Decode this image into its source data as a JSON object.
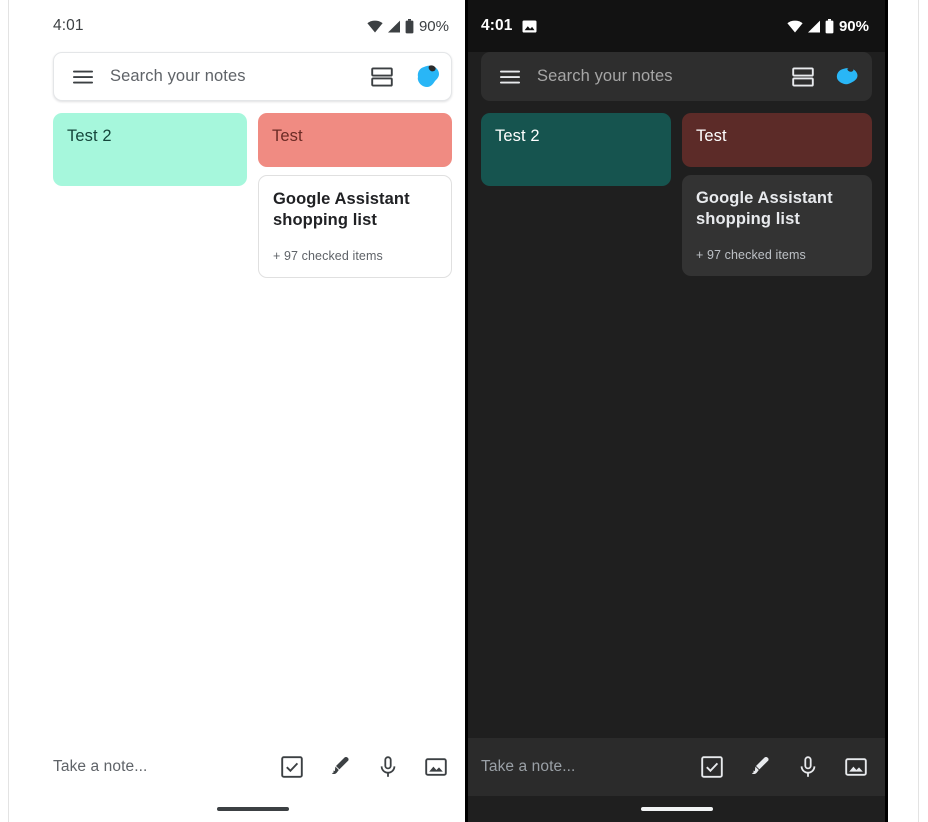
{
  "panels": [
    {
      "theme": "light",
      "statusbar": {
        "time": "4:01",
        "battery_percent": "90%",
        "icons": [
          "wifi-icon",
          "cellular-signal-icon",
          "battery-icon"
        ],
        "notification_icons": []
      },
      "search": {
        "placeholder": "Search your notes",
        "menu_icon": "hamburger-menu-icon",
        "view_toggle_icon": "list-view-icon",
        "avatar_icon": "account-avatar-icon"
      },
      "notes": {
        "left_column": [
          {
            "title": "Test 2",
            "color": "#A6F7DC",
            "text_color": "#15463B",
            "type": "colored"
          }
        ],
        "right_column": [
          {
            "title": "Test",
            "color": "#F08B82",
            "text_color": "#6B2B25",
            "type": "colored"
          },
          {
            "title": "Google Assistant shopping list",
            "subtitle": "+ 97 checked items",
            "type": "plain"
          }
        ]
      },
      "bottombar": {
        "placeholder": "Take a note...",
        "actions": [
          "new-list-icon",
          "new-drawing-icon",
          "new-voice-note-icon",
          "new-image-note-icon"
        ]
      }
    },
    {
      "theme": "dark",
      "statusbar": {
        "time": "4:01",
        "battery_percent": "90%",
        "icons": [
          "wifi-icon",
          "cellular-signal-icon",
          "battery-icon"
        ],
        "notification_icons": [
          "screenshot-icon"
        ]
      },
      "search": {
        "placeholder": "Search your notes",
        "menu_icon": "hamburger-menu-icon",
        "view_toggle_icon": "list-view-icon",
        "avatar_icon": "account-avatar-icon"
      },
      "notes": {
        "left_column": [
          {
            "title": "Test 2",
            "color": "#16544F",
            "text_color": "#FFFFFF",
            "type": "colored"
          }
        ],
        "right_column": [
          {
            "title": "Test",
            "color": "#5C2B28",
            "text_color": "#FFFFFF",
            "type": "colored"
          },
          {
            "title": "Google Assistant shopping list",
            "subtitle": "+ 97 checked items",
            "type": "plain"
          }
        ]
      },
      "bottombar": {
        "placeholder": "Take a note...",
        "actions": [
          "new-list-icon",
          "new-drawing-icon",
          "new-voice-note-icon",
          "new-image-note-icon"
        ]
      }
    }
  ],
  "colors": {
    "light_background": "#FFFFFF",
    "dark_background": "#1F1F1F",
    "dark_surface": "#2E2E2E",
    "dark_bottombar": "#2B2B2B",
    "avatar_blue": "#29B6F6"
  }
}
